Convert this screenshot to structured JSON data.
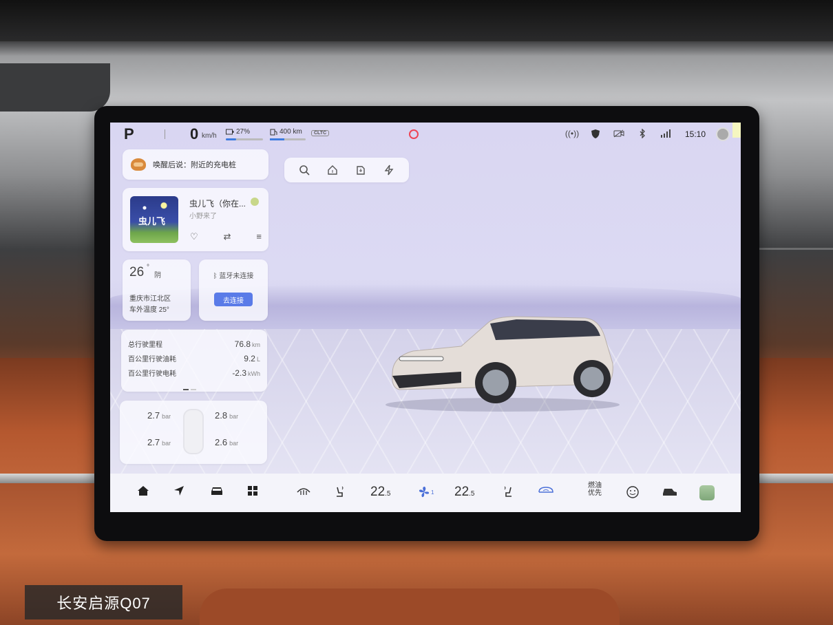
{
  "caption": "长安启源Q07",
  "status_bar": {
    "gear": "P",
    "speed": "0",
    "speed_unit": "km/h",
    "battery_percent": "27%",
    "battery_fraction": 0.27,
    "range": "400 km",
    "range_standard": "CLTC",
    "time": "15:10",
    "icons": [
      "wireless-charging-icon",
      "security-shield-icon",
      "camera-off-icon",
      "bluetooth-icon",
      "signal-icon"
    ]
  },
  "voice_assistant": {
    "text": "唤醒后说：附近的充电桩"
  },
  "music": {
    "album_art_text": "虫儿飞",
    "song": "虫儿飞（你在...",
    "artist": "小野来了",
    "controls": [
      "heart-icon",
      "repeat-icon",
      "playlist-icon"
    ]
  },
  "weather": {
    "temperature": "26",
    "degree": "°",
    "condition": "阴",
    "location": "重庆市江北区",
    "outside_temp_label": "车外温度 25°"
  },
  "bluetooth": {
    "status": "蓝牙未连接",
    "connect_button": "去连接"
  },
  "trip": {
    "rows": [
      {
        "label": "总行驶里程",
        "value": "76.8",
        "unit": "km"
      },
      {
        "label": "百公里行驶油耗",
        "value": "9.2",
        "unit": "L"
      },
      {
        "label": "百公里行驶电耗",
        "value": "-2.3",
        "unit": "kWh"
      }
    ]
  },
  "tire_pressure": {
    "front_left": "2.7",
    "front_right": "2.8",
    "rear_left": "2.7",
    "rear_right": "2.6",
    "unit": "bar"
  },
  "quick_actions": [
    "search-icon",
    "home-icon",
    "company-icon",
    "charging-icon"
  ],
  "dock": {
    "driver_temp": "22",
    "driver_temp_decimal": ".5",
    "passenger_temp": "22",
    "passenger_temp_decimal": ".5",
    "fan_level": "1",
    "fuel_priority_line1": "燃油",
    "fuel_priority_line2": "优先"
  }
}
